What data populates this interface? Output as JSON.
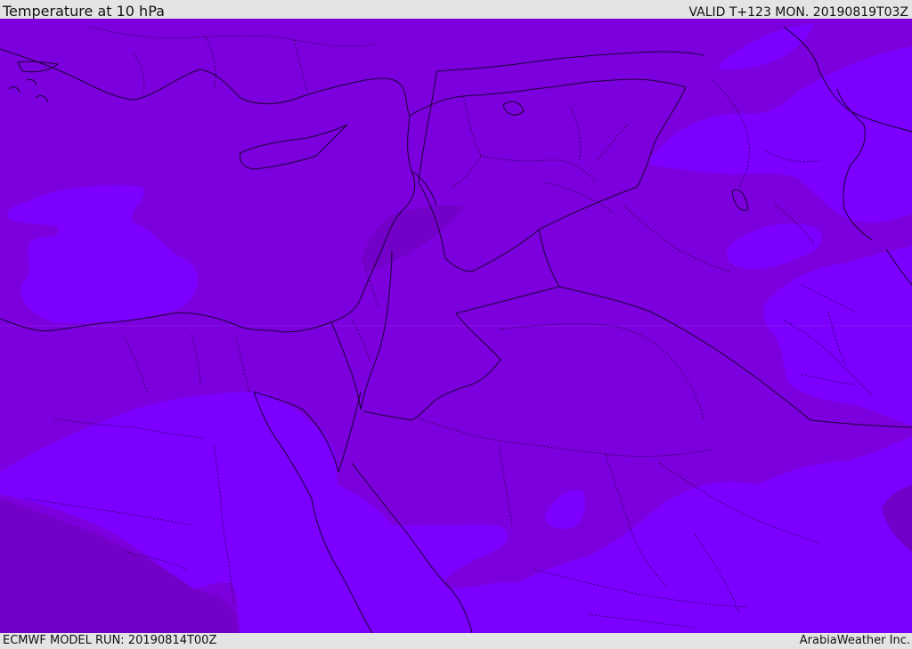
{
  "header": {
    "title": "Temperature at 10 hPa",
    "valid": "VALID T+123 MON. 20190819T03Z"
  },
  "footer": {
    "model_run": "ECMWF MODEL RUN: 20190814T00Z",
    "credit": "ArabiaWeather Inc."
  },
  "map": {
    "field": "temperature",
    "level": "10 hPa",
    "colors": {
      "base": "#7c00de",
      "warmer_band": "#7700c8",
      "colder_band": "#7b00ff",
      "coast_border": "#1a0035"
    }
  }
}
